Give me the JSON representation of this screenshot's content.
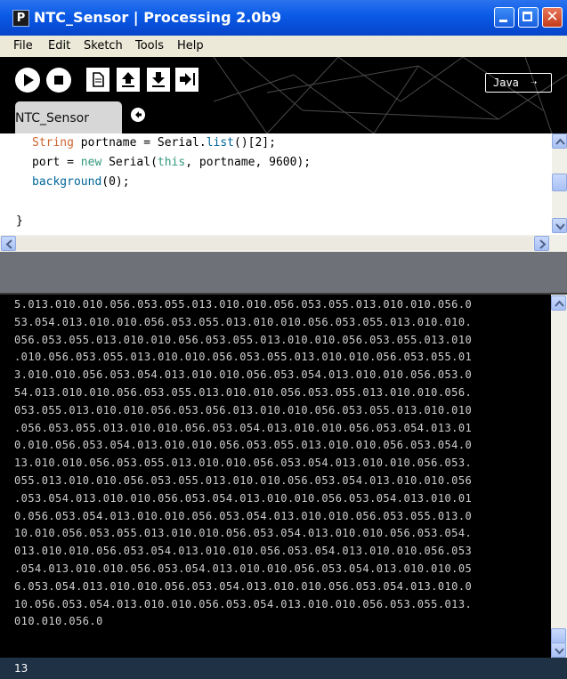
{
  "window": {
    "app_icon_letter": "P",
    "title": "NTC_Sensor | Processing 2.0b9"
  },
  "menu": {
    "items": [
      "File",
      "Edit",
      "Sketch",
      "Tools",
      "Help"
    ]
  },
  "toolbar": {
    "buttons": [
      "run",
      "stop",
      "new",
      "open",
      "save",
      "export"
    ],
    "icons": [
      "play-icon",
      "stop-icon",
      "new-file-icon",
      "open-arrow-up-icon",
      "save-arrow-down-icon",
      "export-arrow-right-icon"
    ],
    "mode_label": "Java",
    "mode_arrow": "➝"
  },
  "tabs": {
    "active_label": "NTC_Sensor"
  },
  "editor": {
    "lines": [
      [
        {
          "t": "String",
          "c": "kw1"
        },
        {
          "t": " portname = Serial.",
          "c": ""
        },
        {
          "t": "list",
          "c": "kw2"
        },
        {
          "t": "()[2];",
          "c": ""
        }
      ],
      [
        {
          "t": "port = ",
          "c": ""
        },
        {
          "t": "new",
          "c": "kw3"
        },
        {
          "t": " Serial(",
          "c": ""
        },
        {
          "t": "this",
          "c": "kw3"
        },
        {
          "t": ", portname, 9600);",
          "c": ""
        }
      ],
      [
        {
          "t": "background",
          "c": "kw2"
        },
        {
          "t": "(0);",
          "c": ""
        }
      ],
      [],
      [
        {
          "t": "}",
          "c": ""
        }
      ]
    ]
  },
  "console": {
    "lines": [
      "5.013.010.010.056.053.055.013.010.010.056.053.055.013.010.010.056.0",
      "53.054.013.010.010.056.053.055.013.010.010.056.053.055.013.010.010.",
      "056.053.055.013.010.010.056.053.055.013.010.010.056.053.055.013.010",
      ".010.056.053.055.013.010.010.056.053.055.013.010.010.056.053.055.01",
      "3.010.010.056.053.054.013.010.010.056.053.054.013.010.010.056.053.0",
      "54.013.010.010.056.053.055.013.010.010.056.053.055.013.010.010.056.",
      "053.055.013.010.010.056.053.056.013.010.010.056.053.055.013.010.010",
      ".056.053.055.013.010.010.056.053.054.013.010.010.056.053.054.013.01",
      "0.010.056.053.054.013.010.010.056.053.055.013.010.010.056.053.054.0",
      "13.010.010.056.053.055.013.010.010.056.053.054.013.010.010.056.053.",
      "055.013.010.010.056.053.055.013.010.010.056.053.054.013.010.010.056",
      ".053.054.013.010.010.056.053.054.013.010.010.056.053.054.013.010.01",
      "0.056.053.054.013.010.010.056.053.054.013.010.010.056.053.055.013.0",
      "10.010.056.053.055.013.010.010.056.053.054.013.010.010.056.053.054.",
      "013.010.010.056.053.054.013.010.010.056.053.054.013.010.010.056.053",
      ".054.013.010.010.056.053.054.013.010.010.056.053.054.013.010.010.05",
      "6.053.054.013.010.010.056.053.054.013.010.010.056.053.054.013.010.0",
      "10.056.053.054.013.010.010.056.053.054.013.010.010.056.053.055.013.",
      "010.010.056.0"
    ]
  },
  "status": {
    "line_number": "13"
  },
  "colors": {
    "titlebar": "#0a5ae6",
    "console_bg": "#000000",
    "console_text": "#cfcfcf",
    "keyword_type": "#cc6633",
    "keyword_function": "#006699",
    "keyword_literal": "#33997e",
    "status_bg": "#1e3145"
  }
}
